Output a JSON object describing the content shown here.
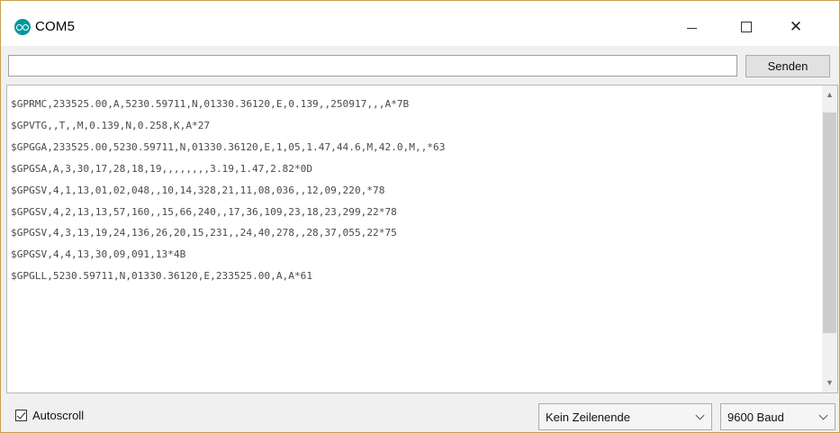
{
  "window": {
    "title": "COM5",
    "app_icon": "arduino-icon",
    "controls": {
      "minimize_icon": "minimize-icon",
      "maximize_icon": "maximize-icon",
      "close_icon": "close-icon",
      "close_glyph": "✕"
    }
  },
  "send": {
    "input_value": "",
    "button_label": "Senden"
  },
  "output": {
    "lines": [
      "$GPRMC,233525.00,A,5230.59711,N,01330.36120,E,0.139,,250917,,,A*7B",
      "$GPVTG,,T,,M,0.139,N,0.258,K,A*27",
      "$GPGGA,233525.00,5230.59711,N,01330.36120,E,1,05,1.47,44.6,M,42.0,M,,*63",
      "$GPGSA,A,3,30,17,28,18,19,,,,,,,,3.19,1.47,2.82*0D",
      "$GPGSV,4,1,13,01,02,048,,10,14,328,21,11,08,036,,12,09,220,*78",
      "$GPGSV,4,2,13,13,57,160,,15,66,240,,17,36,109,23,18,23,299,22*78",
      "$GPGSV,4,3,13,19,24,136,26,20,15,231,,24,40,278,,28,37,055,22*75",
      "$GPGSV,4,4,13,30,09,091,13*4B",
      "$GPGLL,5230.59711,N,01330.36120,E,233525.00,A,A*61"
    ],
    "scroll_up_glyph": "▲",
    "scroll_down_glyph": "▼"
  },
  "footer": {
    "autoscroll_label": "Autoscroll",
    "autoscroll_checked": true,
    "line_ending_selected": "Kein Zeilenende",
    "baud_selected": "9600 Baud"
  },
  "colors": {
    "window_border": "#c8a050",
    "arduino_teal": "#00979c"
  }
}
